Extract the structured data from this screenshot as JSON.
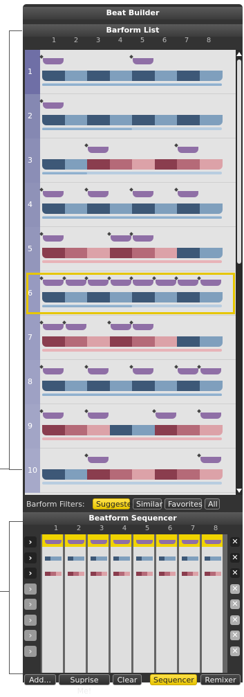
{
  "app": {
    "title": "Beat Builder"
  },
  "barform_list": {
    "title": "Barform List",
    "columns": [
      "1",
      "2",
      "3",
      "4",
      "5",
      "6",
      "7",
      "8"
    ],
    "rows": [
      {
        "label": "1"
      },
      {
        "label": "2"
      },
      {
        "label": "3"
      },
      {
        "label": "4"
      },
      {
        "label": "5"
      },
      {
        "label": "6",
        "selected": true
      },
      {
        "label": "7"
      },
      {
        "label": "8"
      },
      {
        "label": "9"
      },
      {
        "label": "10"
      }
    ]
  },
  "filters": {
    "label": "Barform Filters:",
    "buttons": [
      {
        "label": "Suggested",
        "active": true
      },
      {
        "label": "Similar",
        "active": false
      },
      {
        "label": "Favorites",
        "active": false
      },
      {
        "label": "All",
        "active": false
      }
    ]
  },
  "sequencer": {
    "title": "Beatform Sequencer",
    "columns": [
      "1",
      "2",
      "3",
      "4",
      "5",
      "6",
      "7",
      "8"
    ],
    "rows_active": 3,
    "rows_total": 8,
    "arrow_icon": "chevron-right-icon",
    "remove_icon": "close-icon"
  },
  "bottom_bar": {
    "buttons": [
      {
        "label": "Add...",
        "active": false
      },
      {
        "label": "Suprise Me!",
        "active": false
      },
      {
        "label": "Clear",
        "active": false
      },
      {
        "label": "Sequencer",
        "active": true
      },
      {
        "label": "Remixer",
        "active": false
      }
    ]
  },
  "colors": {
    "accent": "#f0d400",
    "blue_dark": "#3d5877",
    "blue_mid": "#7f9fbd",
    "red_dark": "#8a3d4e",
    "red_mid": "#b56a78",
    "red_light": "#dca2a8",
    "purple": "#8f6fa6"
  }
}
